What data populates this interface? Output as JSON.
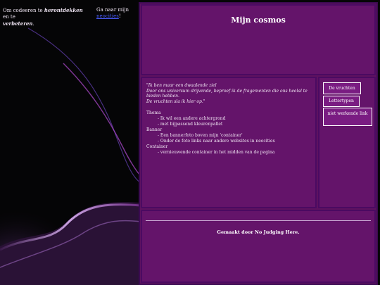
{
  "intro": {
    "prefix": "Om codeeren te ",
    "bold": "herontdekken",
    "suffix": " en te",
    "bold2": "verbeteren",
    "end": "."
  },
  "nav_note": {
    "prefix": "Ga naar mijn",
    "link": "neocities",
    "end": "!"
  },
  "header": {
    "title": "Mijn cosmos"
  },
  "main": {
    "quote": [
      "\"Ik ben maar een dwaalende ziel",
      "Door ons universum drijvende, beproef ik de fragementen die ons heelal te",
      "bieden hebben.",
      "De vruchten sla ik hier op.\""
    ],
    "sections": [
      {
        "title": "Thema",
        "items": [
          "- Ik wil een andere achtergrond",
          "- met bijpassend kleurenpallet"
        ]
      },
      {
        "title": "Banner",
        "items": [
          "- Een bannerfoto boven mijn 'container'",
          "- Onder de foto links naar andere websites in neocities"
        ]
      },
      {
        "title": "Container",
        "items": [
          "- vernieuwende container in het midden van de pagina"
        ]
      }
    ]
  },
  "sidebar": {
    "buttons": [
      "De vruchten",
      "Lettertypen",
      "niet werkende link"
    ]
  },
  "footer": {
    "text": "Gemaakt door No Judging Here."
  },
  "colors": {
    "container_bg": "#5e1260",
    "panel_border": "#4b0a62",
    "link": "#4a5cff"
  }
}
